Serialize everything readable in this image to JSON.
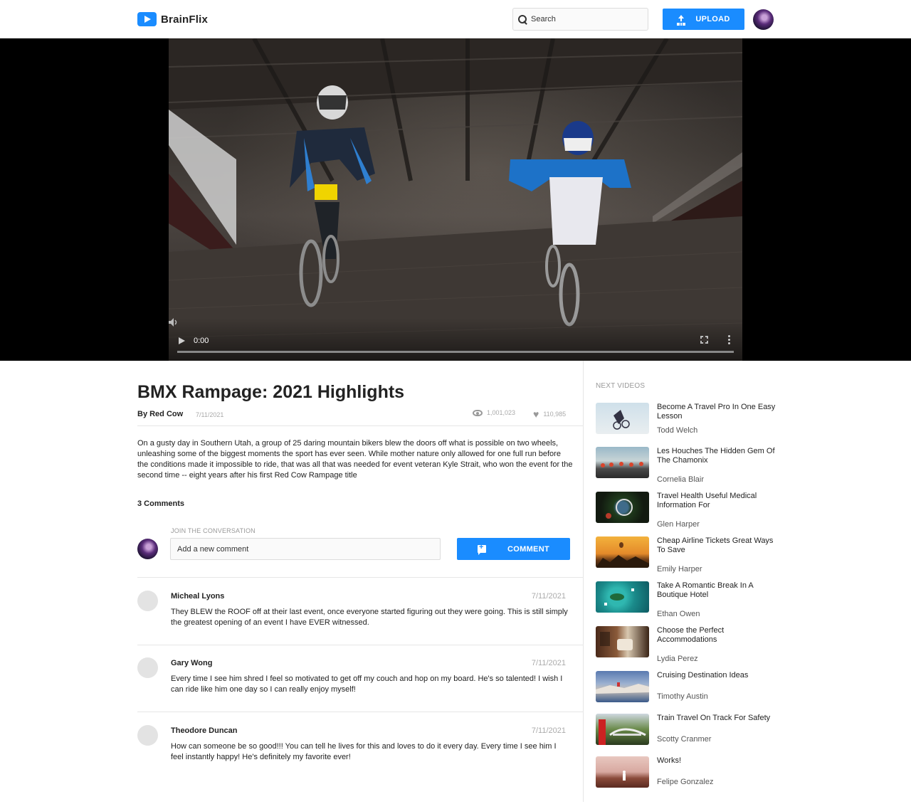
{
  "header": {
    "brand": "BrainFlix",
    "search_placeholder": "Search",
    "upload_label": "UPLOAD"
  },
  "player": {
    "time": "0:00",
    "progress": 0
  },
  "video": {
    "title": "BMX Rampage: 2021 Highlights",
    "channel": "By Red Cow",
    "date": "7/11/2021",
    "views": "1,001,023",
    "likes": "110,985",
    "description": "On a gusty day in Southern Utah, a group of 25 daring mountain bikers blew the doors off what is possible on two wheels, unleashing some of the biggest moments the sport has ever seen. While mother nature only allowed for one full run before the conditions made it impossible to ride, that was all that was needed for event veteran Kyle Strait, who won the event for the second time -- eight years after his first Red Cow Rampage title"
  },
  "comments": {
    "count_label": "3 Comments",
    "join_label": "JOIN THE CONVERSATION",
    "input_placeholder": "Add a new comment",
    "button_label": "COMMENT",
    "items": [
      {
        "name": "Micheal Lyons",
        "date": "7/11/2021",
        "text": "They BLEW the ROOF off at their last event, once everyone started figuring out they were going. This is still simply the greatest opening of an event I have EVER witnessed."
      },
      {
        "name": "Gary Wong",
        "date": "7/11/2021",
        "text": "Every time I see him shred I feel so motivated to get off my couch and hop on my board. He's so talented! I wish I can ride like him one day so I can really enjoy myself!"
      },
      {
        "name": "Theodore Duncan",
        "date": "7/11/2021",
        "text": "How can someone be so good!!! You can tell he lives for this and loves to do it every day. Every time I see him I feel instantly happy! He's definitely my favorite ever!"
      }
    ]
  },
  "next_videos": {
    "label": "NEXT VIDEOS",
    "items": [
      {
        "title": "Become A Travel Pro In One Easy Lesson",
        "author": "Todd Welch"
      },
      {
        "title": "Les Houches The Hidden Gem Of The Chamonix",
        "author": "Cornelia Blair"
      },
      {
        "title": "Travel Health Useful Medical Information For",
        "author": "Glen Harper"
      },
      {
        "title": "Cheap Airline Tickets Great Ways To Save",
        "author": "Emily Harper"
      },
      {
        "title": "Take A Romantic Break In A Boutique Hotel",
        "author": "Ethan Owen"
      },
      {
        "title": "Choose the Perfect Accommodations",
        "author": "Lydia Perez"
      },
      {
        "title": "Cruising Destination Ideas",
        "author": "Timothy Austin"
      },
      {
        "title": "Train Travel On Track For Safety",
        "author": "Scotty Cranmer"
      },
      {
        "title": "Works!",
        "author": "Felipe Gonzalez"
      }
    ]
  },
  "colors": {
    "accent": "#1a8cff"
  }
}
